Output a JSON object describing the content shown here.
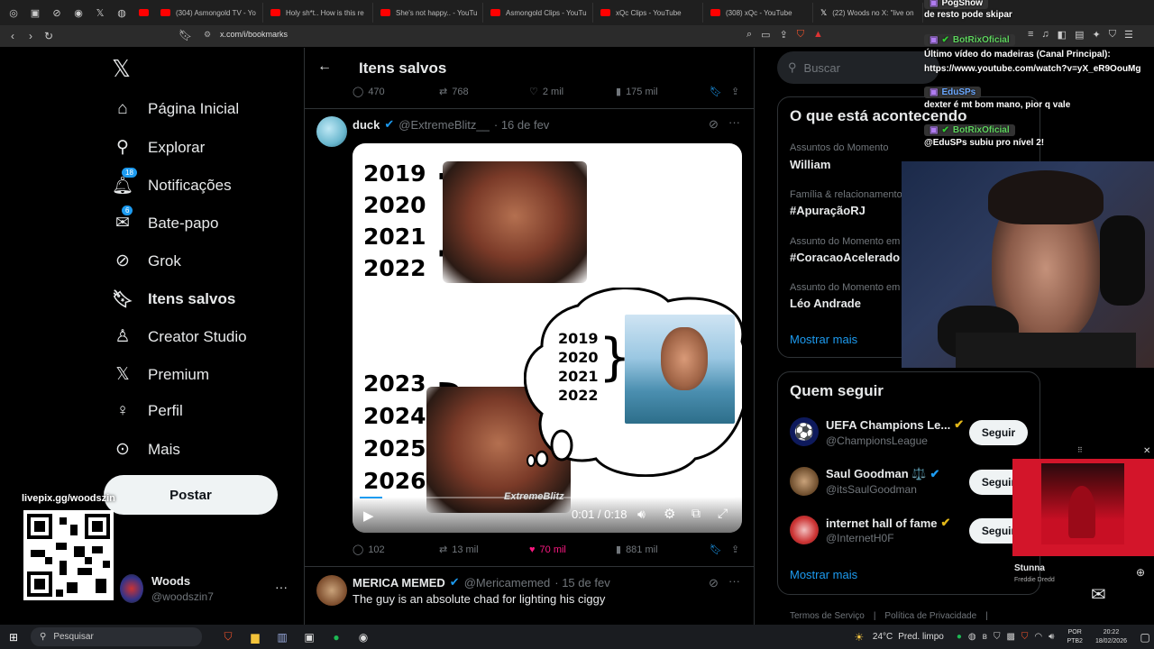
{
  "browser": {
    "tabs": [
      "(304) Asmongold TV - Yo",
      "Holy sh*t.. How is this re",
      "She's not happy.. - YouTu",
      "Asmongold Clips - YouTu",
      "xQc Clips - YouTube",
      "(308) xQc - YouTube",
      "(22) Woods no X: \"live on"
    ],
    "url": "x.com/i/bookmarks"
  },
  "nav": {
    "home": "Página Inicial",
    "explore": "Explorar",
    "notifications": "Notificações",
    "notifications_badge": "18",
    "messages": "Bate-papo",
    "messages_badge": "6",
    "grok": "Grok",
    "bookmarks": "Itens salvos",
    "creator": "Creator Studio",
    "premium": "Premium",
    "profile": "Perfil",
    "more": "Mais",
    "post": "Postar",
    "account_name": "Woods",
    "account_handle": "@woodszin7"
  },
  "header": {
    "title": "Itens salvos"
  },
  "prev_post": {
    "replies": "470",
    "reposts": "768",
    "likes": "2 mil",
    "views": "175 mil"
  },
  "post1": {
    "author": "duck",
    "handle": "@ExtremeBlitz__",
    "date": "· 16 de fev",
    "years_top": [
      "2019",
      "2020",
      "2021",
      "2022"
    ],
    "years_bottom": [
      "2023",
      "2024",
      "2025",
      "2026"
    ],
    "years_bubble": [
      "2019",
      "2020",
      "2021",
      "2022"
    ],
    "watermark": "ExtremeBlitz",
    "time": "0:01 / 0:18",
    "progress": 0.06,
    "replies": "102",
    "reposts": "13 mil",
    "likes": "70 mil",
    "views": "881 mil"
  },
  "post2": {
    "author": "MERICA MEMED",
    "handle": "@Mericamemed",
    "date": "· 15 de fev",
    "text": "The guy is an absolute chad for lighting his ciggy"
  },
  "search": {
    "placeholder": "Buscar"
  },
  "trends": {
    "title": "O que está acontecendo",
    "items": [
      {
        "sub": "Assuntos do Momento",
        "name": "William"
      },
      {
        "sub": "Família & relacionamento",
        "name": "#ApuraçãoRJ"
      },
      {
        "sub": "Assunto do Momento em",
        "name": "#CoracaoAcelerado"
      },
      {
        "sub": "Assunto do Momento em",
        "name": "Léo Andrade"
      }
    ],
    "show_more": "Mostrar mais"
  },
  "who_to_follow": {
    "title": "Quem seguir",
    "items": [
      {
        "name": "UEFA Champions Le...",
        "handle": "@ChampionsLeague",
        "button": "Seguir"
      },
      {
        "name": "Saul Goodman ⚖️",
        "handle": "@itsSaulGoodman",
        "button": "Seguir"
      },
      {
        "name": "internet hall of fame",
        "handle": "@InternetH0F",
        "button": "Seguir"
      }
    ],
    "show_more": "Mostrar mais"
  },
  "footer": {
    "terms": "Termos de Serviço",
    "privacy": "Política de Privacidade"
  },
  "chat": {
    "lines": [
      {
        "user": "PogShow",
        "msg": "de resto pode skipar"
      },
      {
        "user": "BotRixOficial",
        "msg": "Último vídeo do madeiras (Canal Principal): https://www.youtube.com/watch?v=yX_eR9OouMg"
      },
      {
        "user": "EduSPs",
        "msg": "dexter é mt bom mano, pior q vale"
      },
      {
        "user": "BotRixOficial",
        "msg": "@EduSPs subiu pro nível 2!"
      }
    ]
  },
  "spotify": {
    "title": "Stunna",
    "artist": "Freddie Dredd"
  },
  "overlay": {
    "livepix": "livepix.gg/woodszin"
  },
  "taskbar": {
    "search": "Pesquisar",
    "weather": "24°C",
    "weather_desc": "Pred. limpo",
    "lang": "POR",
    "layout": "PTB2",
    "time": "20:22",
    "date": "18/02/2026"
  },
  "colors": {
    "accent": "#1d9bf0",
    "like": "#f91880",
    "gold": "#e2b719"
  }
}
